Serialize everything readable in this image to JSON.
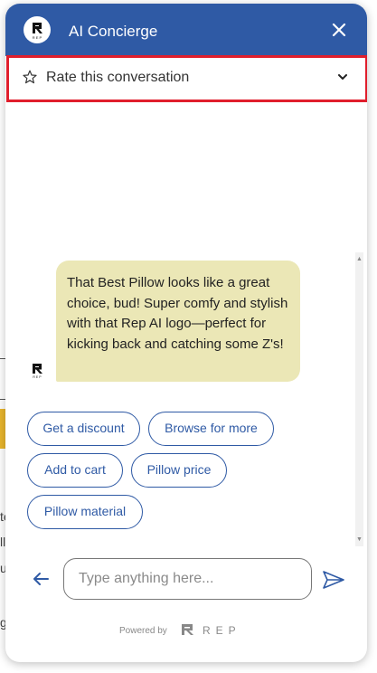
{
  "header": {
    "title": "AI Concierge"
  },
  "rating": {
    "label": "Rate this conversation"
  },
  "message": {
    "text": "That Best Pillow looks like a great choice, bud! Super comfy and stylish with that Rep AI logo—perfect for kicking back and catching some Z's!"
  },
  "suggestions": [
    "Get a discount",
    "Browse for more",
    "Add to cart",
    "Pillow price",
    "Pillow material"
  ],
  "composer": {
    "placeholder": "Type anything here..."
  },
  "footer": {
    "powered_by": "Powered by",
    "brand": "REP"
  },
  "background_fragments": [
    "te",
    "ll",
    "us",
    "g"
  ],
  "colors": {
    "header": "#2f5aa5",
    "highlight_border": "#e01e2c",
    "bubble": "#ebe7b6",
    "chip_text": "#2f5aa5"
  }
}
